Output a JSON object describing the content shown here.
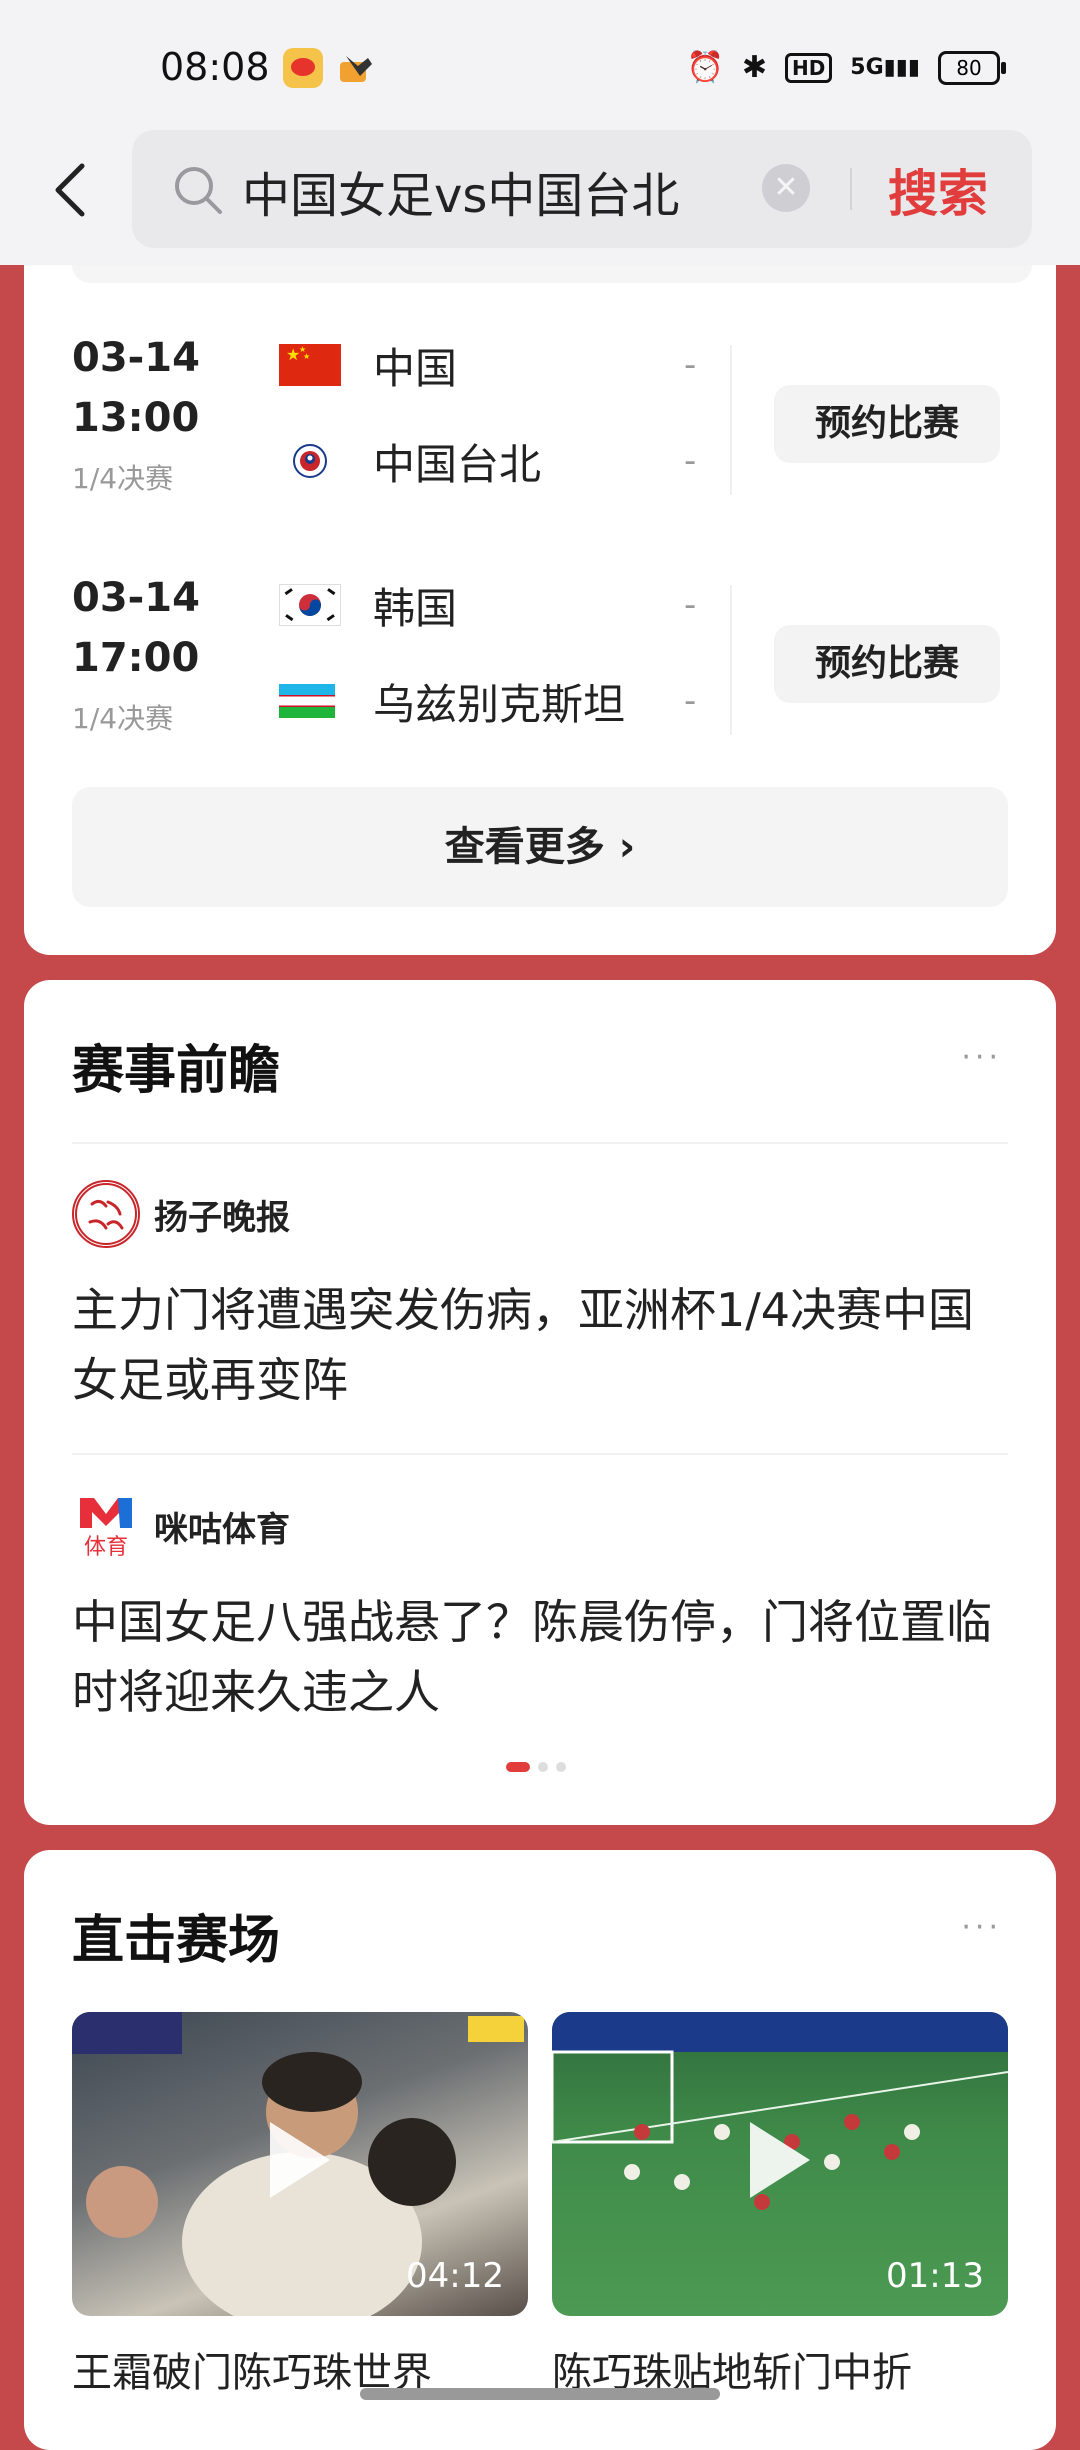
{
  "status_bar": {
    "time": "08:08",
    "network": "5G",
    "hd": "HD",
    "battery": "80"
  },
  "search": {
    "query": "中国女足vs中国台北",
    "button_label": "搜索"
  },
  "schedule": {
    "matches": [
      {
        "date": "03-14",
        "time": "13:00",
        "round": "1/4决赛",
        "team1": {
          "name": "中国",
          "score": "-"
        },
        "team2": {
          "name": "中国台北",
          "score": "-"
        },
        "action": "预约比赛"
      },
      {
        "date": "03-14",
        "time": "17:00",
        "round": "1/4决赛",
        "team1": {
          "name": "韩国",
          "score": "-"
        },
        "team2": {
          "name": "乌兹别克斯坦",
          "score": "-"
        },
        "action": "预约比赛"
      }
    ],
    "more_label": "查看更多 ›"
  },
  "preview": {
    "title": "赛事前瞻",
    "more": "···",
    "items": [
      {
        "source": "扬子晚报",
        "logo_text": "扬子晚报",
        "title": "主力门将遭遇突发伤病，亚洲杯1/4决赛中国女足或再变阵"
      },
      {
        "source": "咪咕体育",
        "logo_text": "体育",
        "title": "中国女足八强战悬了？陈晨伤停，门将位置临时将迎来久违之人"
      }
    ]
  },
  "videos": {
    "title": "直击赛场",
    "more": "···",
    "items": [
      {
        "duration": "04:12",
        "title": "王霜破门陈巧珠世界"
      },
      {
        "duration": "01:13",
        "title": "陈巧珠贴地斩门中折"
      }
    ]
  }
}
